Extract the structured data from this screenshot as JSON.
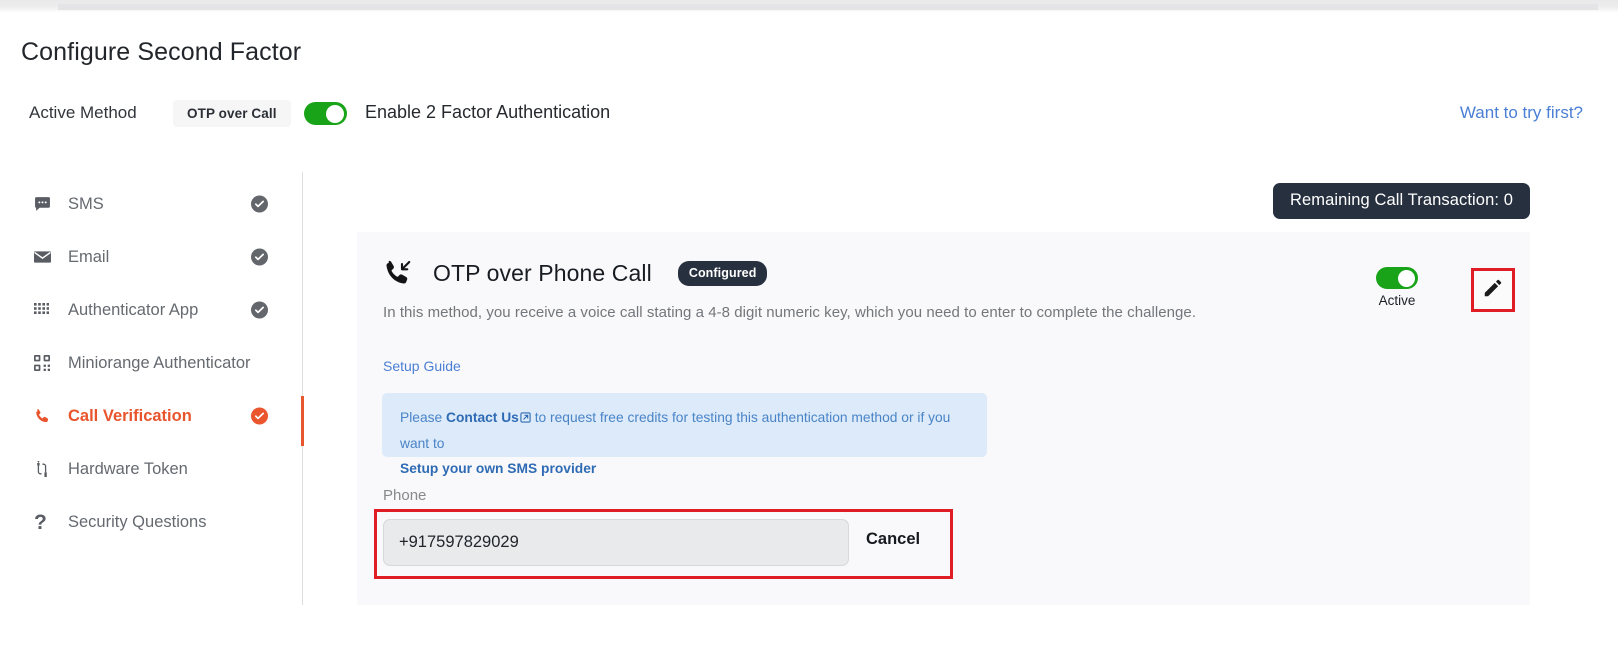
{
  "page": {
    "title": "Configure Second Factor"
  },
  "header": {
    "active_method_label": "Active Method",
    "active_method_value": "OTP over Call",
    "enable_2fa_label": "Enable 2 Factor Authentication",
    "enable_2fa_state": "on",
    "try_first_link": "Want to try first?",
    "accent_green": "#19a319",
    "link_blue": "#4a7fd4"
  },
  "sidebar": {
    "items": [
      {
        "label": "SMS",
        "icon": "chat-bubble-icon",
        "configured": true,
        "active": false
      },
      {
        "label": "Email",
        "icon": "envelope-icon",
        "configured": true,
        "active": false
      },
      {
        "label": "Authenticator App",
        "icon": "grid-dots-icon",
        "configured": true,
        "active": false
      },
      {
        "label": "Miniorange Authenticator",
        "icon": "qr-code-icon",
        "configured": false,
        "active": false
      },
      {
        "label": "Call Verification",
        "icon": "phone-icon",
        "configured": true,
        "active": true
      },
      {
        "label": "Hardware Token",
        "icon": "usb-token-icon",
        "configured": false,
        "active": false
      },
      {
        "label": "Security Questions",
        "icon": "question-mark-icon",
        "configured": false,
        "active": false
      }
    ],
    "active_color": "#e8552d",
    "check_color": "#63666b",
    "check_active_color": "#ea562e"
  },
  "remaining": {
    "text": "Remaining Call Transaction: 0",
    "background": "#27303f"
  },
  "card": {
    "title": "OTP over Phone Call",
    "badge": "Configured",
    "description": "In this method, you receive a voice call stating a 4-8 digit numeric key, which you need to enter to complete the challenge.",
    "setup_guide_link": "Setup Guide",
    "info_box": {
      "lead": "Please ",
      "contact_us": "Contact Us",
      "middle": " to request free credits for testing this authentication method or if you want to",
      "provider_link": "Setup your own SMS provider",
      "background": "#dceaf9",
      "text_color": "#4a84c7"
    },
    "phone_field": {
      "label": "Phone",
      "value": "+917597829029",
      "placeholder": "Enter phone number"
    },
    "cancel_label": "Cancel",
    "toggle_label": "Active",
    "toggle_state": "on",
    "edit_icon": "pencil-icon",
    "highlight_color": "#e01c24",
    "background": "#f9f9fb"
  }
}
